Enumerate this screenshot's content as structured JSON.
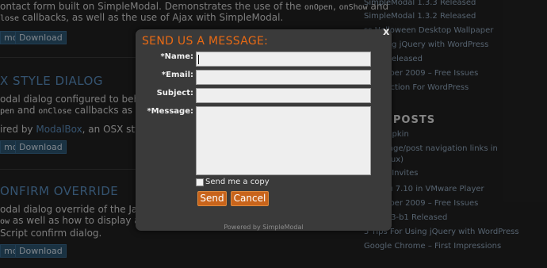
{
  "background": {
    "section1": {
      "line1_prefix": "ontact form built on SimpleModal. Demonstrates the use of the ",
      "line1_code1": "onOpen",
      "line1_sep": ", ",
      "line1_code2": "onShow",
      "line1_suffix": " and",
      "line2_code": "lose",
      "line2_text": " callbacks, as well as the use of Ajax with SimpleModal.",
      "demo_label": "mo",
      "download_label": "Download"
    },
    "section2": {
      "heading": "X STYLE DIALOG",
      "line1": "odal dialog configured to behave li",
      "line2_code1": "pen",
      "line2_mid": " and ",
      "line2_code2": "onClose",
      "line2_suffix": " callbacks as well as",
      "line3_prefix": "ired by ",
      "line3_link": "ModalBox",
      "line3_suffix": ", an OSX style dia",
      "demo_label": "mo",
      "download_label": "Download"
    },
    "section3": {
      "heading": "ONFIRM OVERRIDE",
      "line1": "odal dialog override of the JavaScri",
      "line2_code": "ow",
      "line2_text": " as well as how to display a mod",
      "line3": "Script confirm dialog.",
      "demo_label": "mo",
      "download_label": "Download"
    },
    "sidebar": {
      "recent_links": [
        "SimpleModal 1.3.3 Released",
        "SimpleModal 1.3.2 Released",
        "ss Halloween Desktop Wallpaper",
        "or Using jQuery with WordPress",
        "inate Released",
        "eptember 2009 – Free Issues",
        "on Function For WordPress"
      ],
      "heading": "LAR POSTS",
      "popular_links": [
        "ss Pumpkin",
        "onal page/post navigation links in",
        "ss (redux)",
        "k Beta Invites",
        "Ubuntu 7.10 in VMware Player",
        "eptember 2009 – Free Issues",
        "odal 1.3-b1 Released",
        "5 Tips For Using jQuery with WordPress",
        "Google Chrome – First Impressions"
      ]
    }
  },
  "modal": {
    "close_label": "x",
    "title": "SEND US A MESSAGE:",
    "fields": {
      "name_label": "*Name:",
      "name_value": "",
      "email_label": "*Email:",
      "email_value": "",
      "subject_label": "Subject:",
      "subject_value": "",
      "message_label": "*Message:",
      "message_value": ""
    },
    "send_copy_label": "Send me a copy",
    "send_copy_checked": false,
    "send_label": "Send",
    "cancel_label": "Cancel",
    "powered_by": "Powered by SimpleModal"
  },
  "colors": {
    "title_orange": "#e96a14",
    "button_orange": "#c8641b",
    "link_blue": "#5a8fc2",
    "modal_bg": "#3a3a3a"
  }
}
